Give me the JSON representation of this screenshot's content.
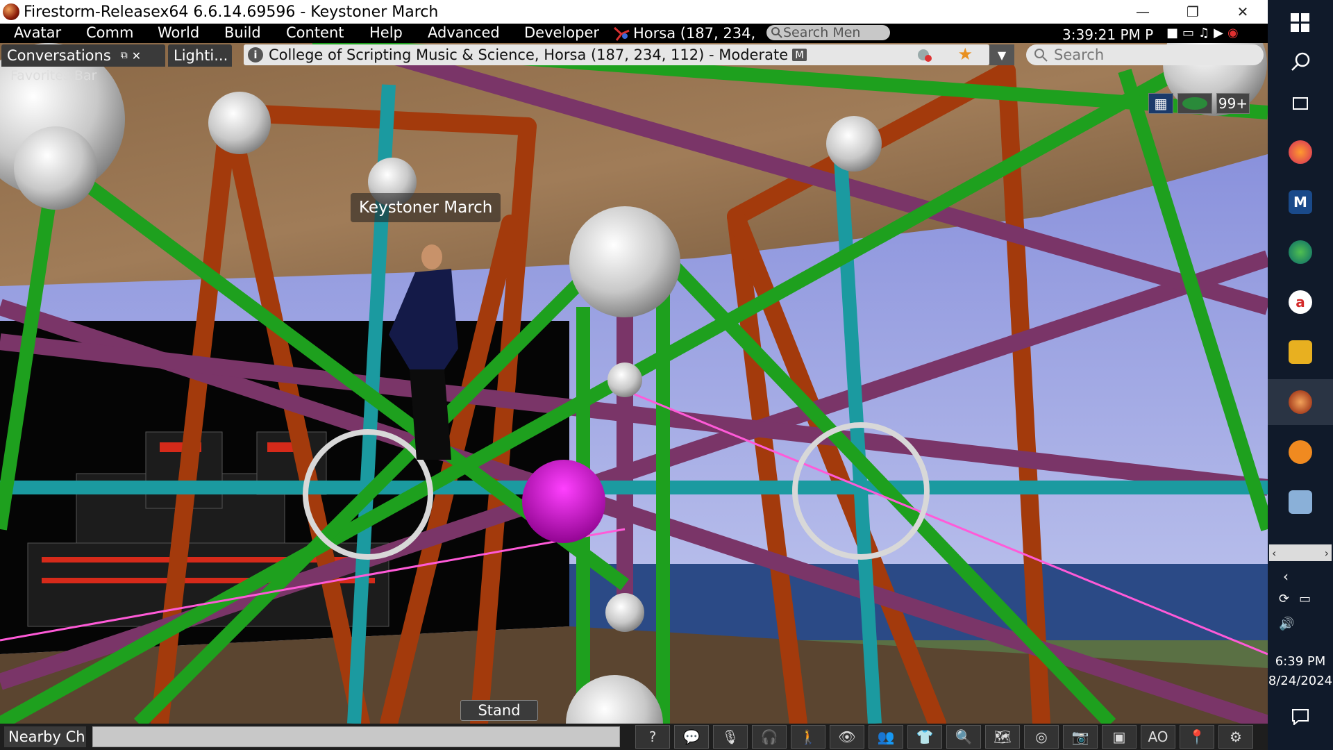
{
  "window": {
    "title": "Firestorm-Releasex64 6.6.14.69596 - Keystoner March",
    "minimize_glyph": "—",
    "restore_glyph": "❐",
    "close_glyph": "✕"
  },
  "menubar": {
    "items": [
      "Avatar",
      "Comm",
      "World",
      "Build",
      "Content",
      "Help",
      "Advanced",
      "Developer"
    ],
    "location_short": "Horsa (187, 234,",
    "search_placeholder": "Search Men",
    "clock": "3:39:21 PM P"
  },
  "tabs": {
    "conversations": "Conversations",
    "lighting": "Lighti...",
    "favorites_bar": "Favorites Bar"
  },
  "navbar": {
    "info_glyph": "i",
    "location": "College of Scripting Music & Science, Horsa (187, 234, 112) - Moderate",
    "rating_badge": "M",
    "search_placeholder": "Search"
  },
  "hud": {
    "notification_count": "99+"
  },
  "scene": {
    "avatar_name": "Keystoner March",
    "stand_label": "Stand"
  },
  "bottombar": {
    "chat_channel": "Nearby Ch",
    "voice_label": "AO"
  },
  "taskbar": {
    "time": "6:39 PM",
    "date": "8/24/2024"
  },
  "colors": {
    "titlebar_bg": "#ffffff",
    "menubar_bg": "#000000",
    "beam_green": "#1ea01e",
    "beam_orange": "#a33a0c",
    "beam_purple": "#7a3568",
    "beam_cyan": "#1b9aa0",
    "sphere_magenta": "#c800c8",
    "taskbar_bg": "#101a2a"
  },
  "icons": [
    "windows-start-icon",
    "search-icon",
    "task-view-icon",
    "firefox-icon",
    "maple-icon",
    "edge-icon",
    "acrobat-icon",
    "notes-icon",
    "firestorm-icon",
    "audacity-icon",
    "network-icon",
    "notification-icon"
  ]
}
